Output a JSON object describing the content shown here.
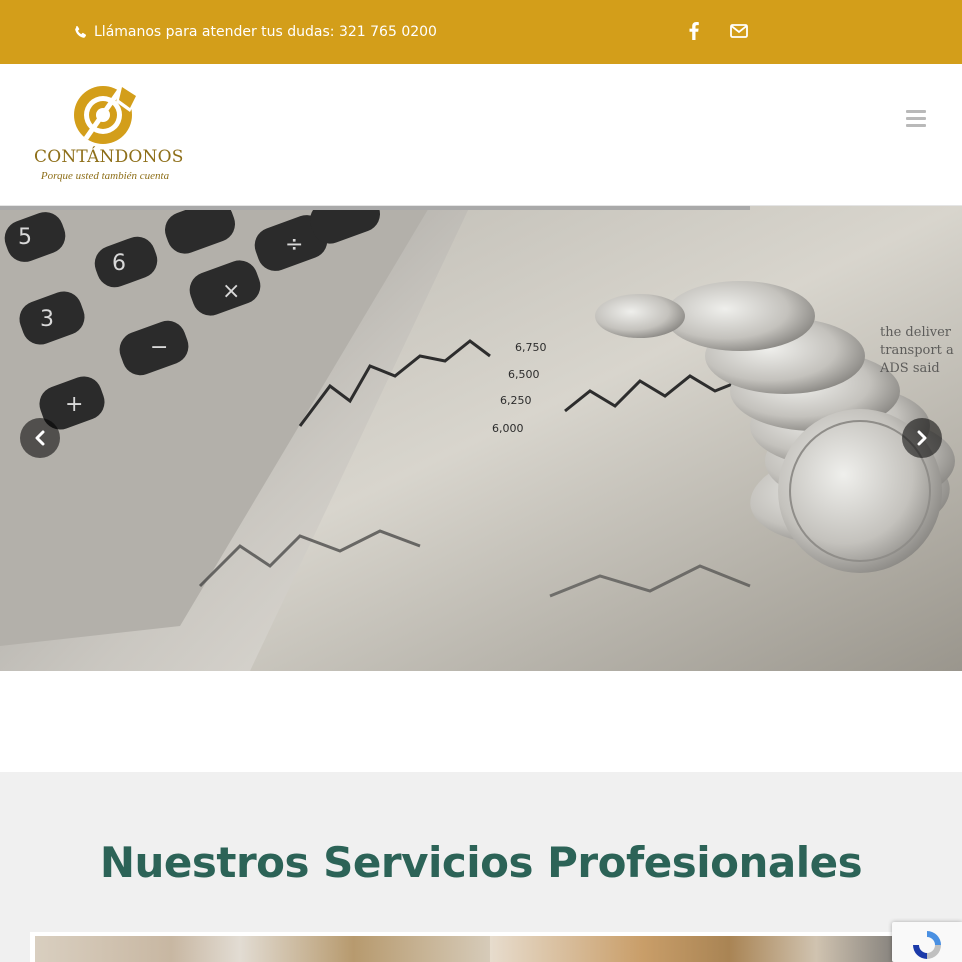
{
  "topbar": {
    "phone_icon": "phone-icon",
    "contact_text": "Llámanos para atender tus dudas: 321 765 0200",
    "social": [
      {
        "icon": "facebook-icon"
      },
      {
        "icon": "envelope-icon"
      }
    ],
    "bg_color": "#d39e1a"
  },
  "header": {
    "logo": {
      "name": "CONTÁNDONOS",
      "tagline": "Porque usted también cuenta",
      "color": "#8e6f19"
    },
    "menu_icon": "hamburger-menu-icon"
  },
  "slider": {
    "image": "calculator, coins and stock chart photo",
    "prev_icon": "chevron-left-icon",
    "next_icon": "chevron-right-icon",
    "progress_fraction": 0.78
  },
  "services": {
    "title": "Nuestros Servicios Profesionales",
    "title_color": "#2c6357"
  },
  "recaptcha": {
    "icon": "recaptcha-icon"
  }
}
